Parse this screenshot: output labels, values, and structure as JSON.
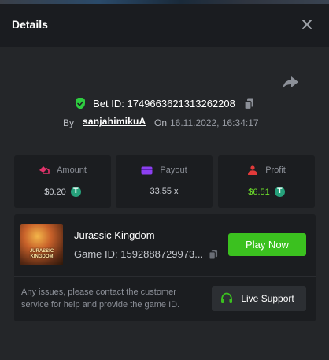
{
  "header": {
    "title": "Details"
  },
  "bet": {
    "id_label": "Bet ID: 1749663621313262208",
    "by_label": "By",
    "username": "sanjahimikuA",
    "on_label": "On",
    "datetime": "16.11.2022, 16:34:17"
  },
  "stats": {
    "amount": {
      "label": "Amount",
      "value": "$0.20"
    },
    "payout": {
      "label": "Payout",
      "value": "33.55 x"
    },
    "profit": {
      "label": "Profit",
      "value": "$6.51"
    }
  },
  "game": {
    "thumb_text": "JURASSIC KINGDOM",
    "name": "Jurassic Kingdom",
    "id_label": "Game ID: 1592888729973...",
    "play_label": "Play Now"
  },
  "support": {
    "message": "Any issues, please contact the customer service for help and provide the game ID.",
    "button_label": "Live Support"
  },
  "colors": {
    "accent_green": "#3bc11f",
    "profit_green": "#6ee02b",
    "amount_pink": "#e2336b",
    "payout_purple": "#8b3ff0",
    "profit_red": "#e23a3a",
    "verified_green": "#2ecc40",
    "coin_teal": "#26a17b"
  },
  "icons": {
    "close": "close-icon",
    "share": "share-arrow-icon",
    "verified": "shield-check-icon",
    "copy": "copy-icon",
    "amount": "amount-icon",
    "payout": "wallet-card-icon",
    "profit": "profit-person-icon",
    "coin": "tether-coin-icon",
    "support": "headset-icon"
  }
}
